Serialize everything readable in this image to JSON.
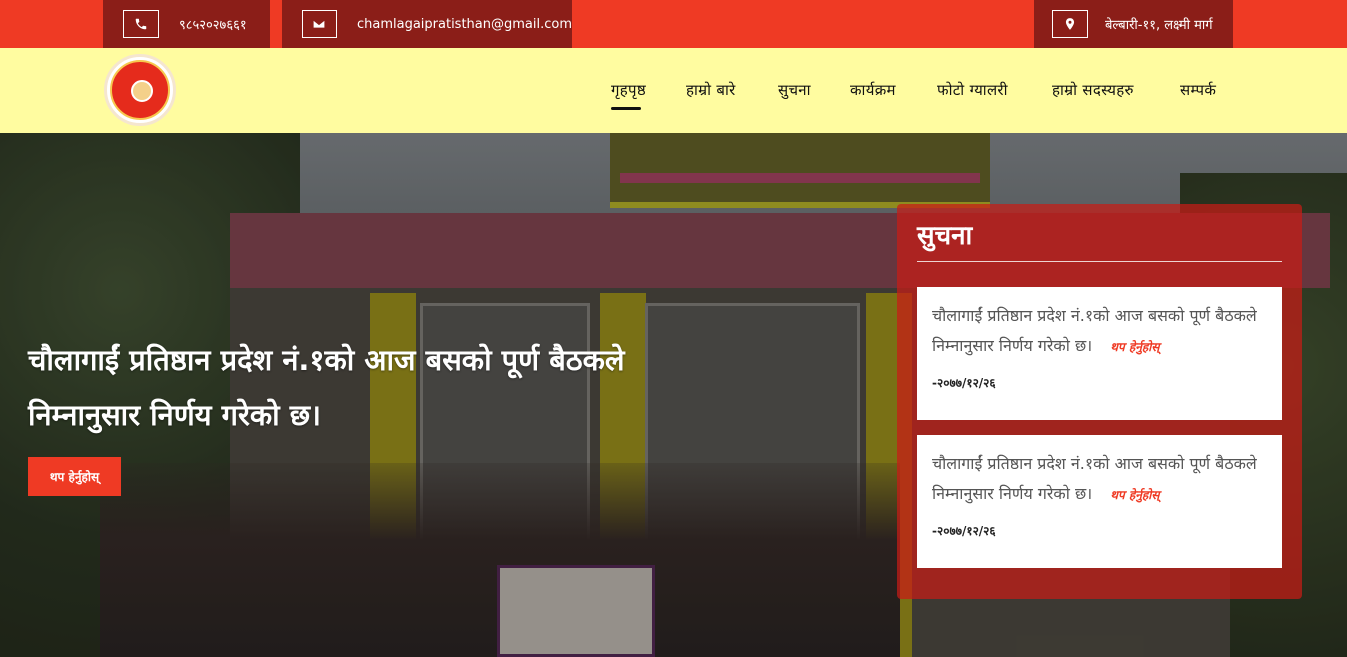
{
  "topbar": {
    "phone": "९८५२०२७६६१",
    "email": "chamlagaipratisthan@gmail.com",
    "address": "बेल्बारी-११, लक्ष्मी मार्ग",
    "icons": [
      "phone-icon",
      "envelope-icon",
      "map-marker-icon"
    ]
  },
  "nav": {
    "items": [
      {
        "label": "गृहपृष्ठ",
        "active": true
      },
      {
        "label": "हाम्रो बारे"
      },
      {
        "label": "सुचना"
      },
      {
        "label": "कार्यक्रम"
      },
      {
        "label": "फोटो ग्यालरी"
      },
      {
        "label": "हाम्रो सदस्यहरु"
      },
      {
        "label": "सम्पर्क"
      }
    ]
  },
  "hero": {
    "title": "चौलागाईं प्रतिष्ठान प्रदेश नं.१को आज बसको पूर्ण बैठकले निम्नानुसार निर्णय गरेको छ।",
    "button": "थप हेर्नुहोस्"
  },
  "notice": {
    "title": "सुचना",
    "items": [
      {
        "text": "चौलागाईं प्रतिष्ठान प्रदेश नं.१को आज बसको पूर्ण बैठकले निम्नानुसार निर्णय गरेको छ।",
        "more": "थप हेर्नुहोस्",
        "date": "-२०७७/१२/२६"
      },
      {
        "text": "चौलागाईं प्रतिष्ठान प्रदेश नं.१को आज बसको पूर्ण बैठकले निम्नानुसार निर्णय गरेको छ।",
        "more": "थप हेर्नुहोस्",
        "date": "-२०७७/१२/२६"
      }
    ]
  },
  "colors": {
    "topbar": "#ef3a24",
    "topbar_box": "#8b1e18",
    "header": "#fffca0",
    "accent": "#ef3a24"
  }
}
